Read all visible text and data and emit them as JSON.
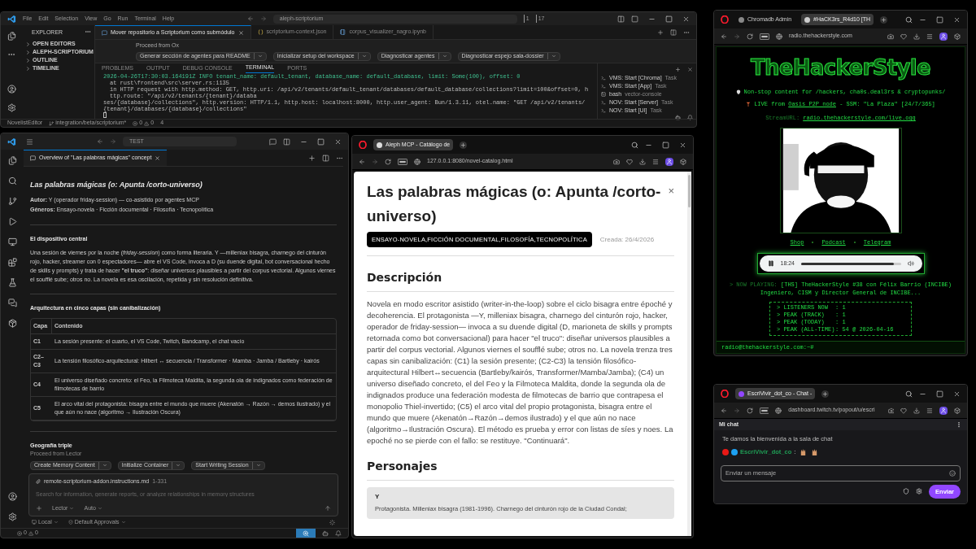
{
  "editor_top": {
    "menu": [
      "File",
      "Edit",
      "Selection",
      "View",
      "Go",
      "Run",
      "Terminal",
      "Help"
    ],
    "command_center": "aleph-scriptorium",
    "counters": [
      "1",
      "17"
    ],
    "explorer": {
      "title": "EXPLORER",
      "sections": [
        {
          "label": "OPEN EDITORS",
          "expanded": false
        },
        {
          "label": "ALEPH-SCRIPTORIUM",
          "expanded": false
        },
        {
          "label": "OUTLINE",
          "expanded": false
        },
        {
          "label": "TIMELINE",
          "expanded": false
        }
      ]
    },
    "tabs": [
      {
        "label": "Mover repositorio a Scriptorium como submódulo",
        "kind": "chat",
        "selected": true
      },
      {
        "label": "scriptorium-context.json",
        "kind": "json",
        "selected": false
      },
      {
        "label": "corpus_visualizer_nagro.ipynb",
        "kind": "notebook",
        "selected": false
      }
    ],
    "proceed": {
      "label": "Proceed from Ox",
      "actions": [
        "Generar sección de agentes para README",
        "Inicializar setup del workspace",
        "Diagnosticar agentes",
        "Diagnosticar espejo sala-dossier"
      ]
    },
    "panel_tabs": [
      {
        "label": "PROBLEMS",
        "selected": false
      },
      {
        "label": "OUTPUT",
        "selected": false
      },
      {
        "label": "DEBUG CONSOLE",
        "selected": false
      },
      {
        "label": "TERMINAL",
        "selected": true
      },
      {
        "label": "PORTS",
        "selected": false
      }
    ],
    "terminal_lines": [
      {
        "kind": "log",
        "text": "2026-04-26T17:30:03.164191Z  INFO  tenant_name: default_tenant, database_name: default_database, limit: Some(100), offset: 0"
      },
      {
        "kind": "trace",
        "text": "at rust\\frontend\\src\\server.rs:1135"
      },
      {
        "kind": "trace",
        "text": "in HTTP request with http.method: GET, http.uri: /api/v2/tenants/default_tenant/databases/default_database/collections?limit=100&offset=0, http.route: \"/api/v2/tenants/{tenant}/databa"
      },
      {
        "kind": "plain",
        "text": "ses/{database}/collections\", http.version: HTTP/1.1, http.host: localhost:8000, http.user_agent: Bun/1.3.11, otel.name: \"GET /api/v2/tenants/{tenant}/databases/{database}/collections\""
      }
    ],
    "terminals": [
      {
        "label": "VMS: Start [Chroma]",
        "detail": "Task",
        "kind": "task"
      },
      {
        "label": "VMS: Start [App]",
        "detail": "Task",
        "kind": "task"
      },
      {
        "label": "bash",
        "detail": "vector-console",
        "kind": "shell"
      },
      {
        "label": "NOV: Start [Server]",
        "detail": "Task",
        "kind": "task"
      },
      {
        "label": "NOV: Start [UI]",
        "detail": "Task",
        "kind": "task"
      }
    ],
    "status": {
      "workspace": "NovelistEditor",
      "branch": "integration/beta/scriptorium*",
      "errors": "0",
      "warnings": "0",
      "ports": "4"
    }
  },
  "editor_chat": {
    "command_center": "TEST",
    "tab": "Overview of \"Las palabras mágicas\" concept",
    "title": "Las palabras mágicas (o: Apunta /corto-universo)",
    "meta": [
      {
        "label": "Autor:",
        "value": "Y (operador friday-session) — co-asistido por agentes MCP"
      },
      {
        "label": "Géneros:",
        "value": "Ensayo-novela · Ficción documental · Filosofía · Tecnopolítica"
      }
    ],
    "section_heading": "El dispositivo central",
    "paragraph": "Una sesión de viernes por la noche (*friday-session*) como forma literaria. Y —milleniax bisagra, charnego del cinturón rojo, hacker, streamer con 0 espectadores— abre el VS Code, invoca a D (su duende digital, bot conversacional hecho de skills y prompts) y trata de hacer **\"el truco\"**: diseñar universos plausibles a partir del corpus vectorial. Algunos viernes el soufflé sube; otros no. La novela es esa oscilación, repetida y sin resolución definitiva.",
    "table_heading": "Arquitectura en cinco capas (sin canibalización)",
    "table": {
      "columns": [
        "Capa",
        "Contenido"
      ],
      "rows": [
        [
          "C1",
          "La sesión presente: el cuarto, el VS Code, Twitch, Bandcamp, el chat vacío"
        ],
        [
          "C2–C3",
          "La tensión filosófico-arquitectural: Hilbert ↔ secuencia / Transformer · Mamba · Jamba / Bartleby · kairós"
        ],
        [
          "C4",
          "El universo diseñado concreto: el Feo, la Filmoteca Maldita, la segunda ola de indignados como federación de filmotecas de barrio"
        ],
        [
          "C5",
          "El arco vital del protagonista: bisagra entre el mundo que muere (Akenatón → Razón → demos ilustrado) y el que aún no nace (algoritmo → Ilustración Oscura)"
        ]
      ]
    },
    "next_heading": "Geografía triple",
    "proceed": {
      "label": "Proceed from Lector",
      "actions": [
        "Create Memory Content",
        "Initialize Container",
        "Start Writing Session"
      ]
    },
    "input": {
      "attachment": "remote-scriptorium-addon.instructions.md",
      "range": "1-331",
      "placeholder": "Search for information, generate reports, or analyze relationships in memory structures",
      "mode": "Lector",
      "model": "Auto"
    },
    "footer": [
      "Local",
      "Default Approvals"
    ],
    "status": {
      "errors": "0",
      "warnings": "0"
    }
  },
  "catalog_browser": {
    "tab": "Aleph MCP - Catálogo de",
    "url": "127.0.0.1:8080/novel-catalog.html",
    "title": "Las palabras mágicas (o: Apunta /corto-universo)",
    "close": "×",
    "genres": "ENSAYO-NOVELA,FICCIÓN DOCUMENTAL,FILOSOFÍA,TECNOPOLÍTICA",
    "created": "Creada: 26/4/2026",
    "description_heading": "Descripción",
    "description": "Novela en modo escritor asistido (writer-in-the-loop) sobre el ciclo bisagra entre époché y decoherencia. El protagonista —Y, milleniax bisagra, charnego del cinturón rojo, hacker, operador de friday-session— invoca a su duende digital (D, marioneta de skills y prompts retornada como bot conversacional) para hacer \"el truco\": diseñar universos plausibles a partir del corpus vectorial. Algunos viernes el soufflé sube; otros no. La novela trenza tres capas sin canibalización: (C1) la sesión presente; (C2-C3) la tensión filosófico-arquitectural Hilbert↔secuencia (Bartleby/kairós, Transformer/Mamba/Jamba); (C4) un universo diseñado concreto, el del Feo y la Filmoteca Maldita, donde la segunda ola de indignados produce una federación modesta de filmotecas de barrio que contrapesa el monopolio Thiel-invertido; (C5) el arco vital del propio protagonista, bisagra entre el mundo que muere (Akenatón→Razón→demos ilustrado) y el que aún no nace (algoritmo→Ilustración Oscura). El método es prueba y error con listas de síes y noes. La epoché no se pierde con el fallo: se restituye. \"Continuará\".",
    "characters_heading": "Personajes",
    "character": {
      "name": "Y",
      "text": "Protagonista. Milleniax bisagra (1981-1996). Charnego del cinturón rojo de la Ciudad Condal;"
    }
  },
  "radio_browser": {
    "tabs": [
      {
        "label": "Chromadb Admin",
        "selected": false
      },
      {
        "label": "#HaCK3rs_R4d10 [TH",
        "selected": true
      }
    ],
    "url": "radio.thehackerstyle.com",
    "logo": "TheHackerStyle",
    "tagline": "Non-stop content for /hackers, cha0s.deal3rs & cryptopunks/",
    "live": {
      "prefix": "LIVE from",
      "link": "Oasis P2P node",
      "suffix": "- SSM: \"La Plaza\" [24/7/365]"
    },
    "stream": {
      "label": "StreamURL:",
      "link": "radio.thehackerstyle.com/live.ogg"
    },
    "links": [
      "Shop",
      "Podcast",
      "Telegram"
    ],
    "player": {
      "playing": true,
      "time": "18:24",
      "level": 0.93
    },
    "now_playing": {
      "label": "> NOW PLAYING:",
      "text": "[THS] TheHackerStyle #38 con Félix Barrio (INCIBE) Ingeniero, CISM y Director General de INCIBE..."
    },
    "stats": [
      {
        "label": "> LISTENERS NOW",
        "value": ": 1"
      },
      {
        "label": "> PEAK (TRACK)",
        "value": ": 1"
      },
      {
        "label": "> PEAK (TODAY)",
        "value": ": 1"
      },
      {
        "label": "> PEAK (ALL-TIME)",
        "value": ": 54 @ 2026-04-16"
      }
    ],
    "prompt": "radio@thehackerstyle.com:~#"
  },
  "chat_browser": {
    "tab": "EscriVivir_dot_co - Chat -",
    "url": "dashboard.twitch.tv/popout/u/escri",
    "header": "Mi chat",
    "welcome": "Te damos la bienvenida a la sala de chat",
    "message": {
      "user": "EscriVivir_dot_co",
      "color": "#1f9d55",
      "colon": ":"
    },
    "placeholder": "Enviar un mensaje",
    "send": "Enviar"
  }
}
